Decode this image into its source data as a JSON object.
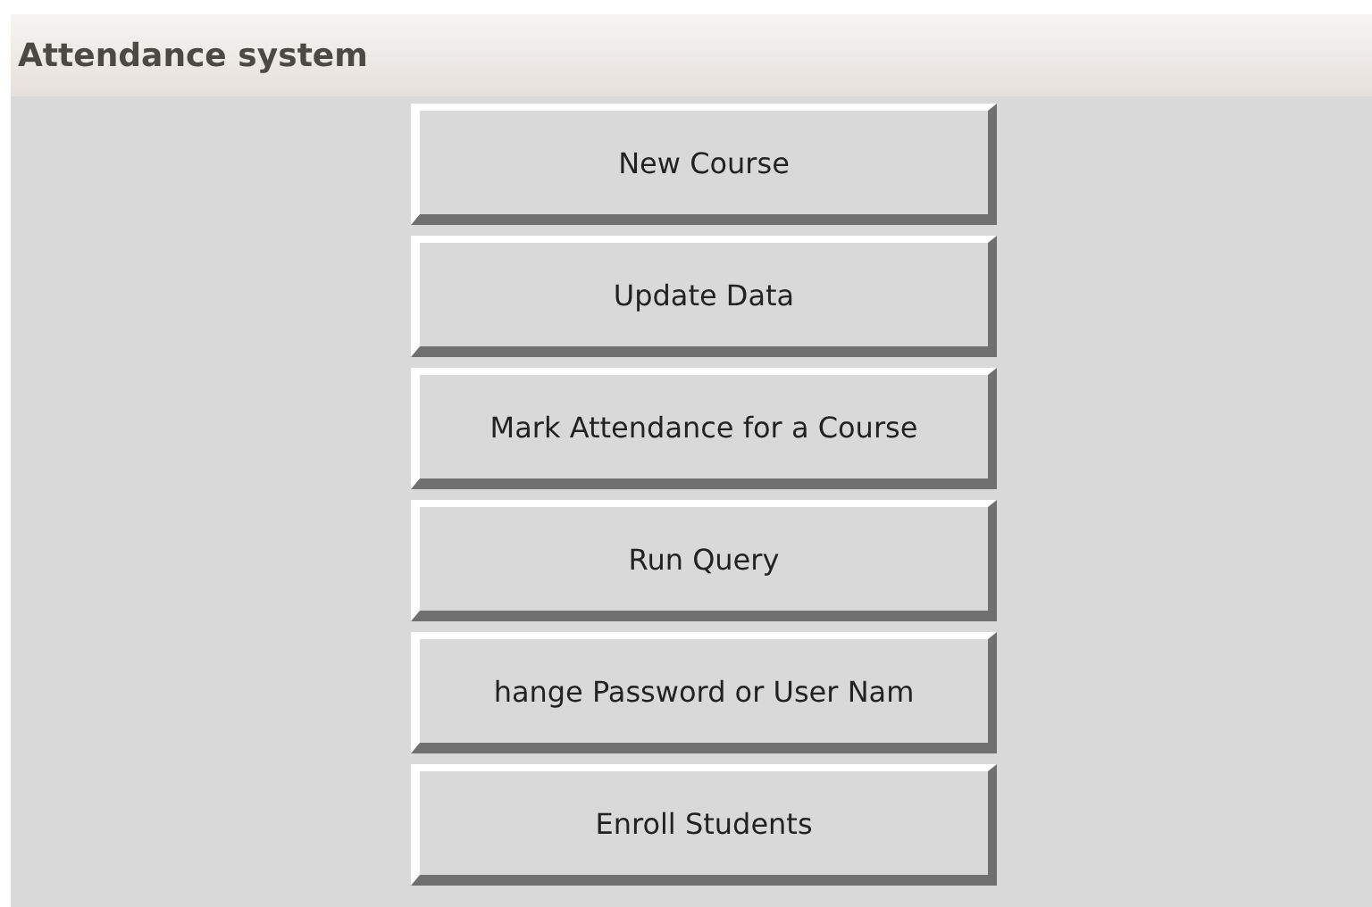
{
  "window": {
    "title": "Attendance system"
  },
  "buttons": [
    {
      "label": "New Course"
    },
    {
      "label": "Update Data"
    },
    {
      "label": "Mark Attendance for a Course"
    },
    {
      "label": "Run Query"
    },
    {
      "label": "hange Password or User Nam"
    },
    {
      "label": "Enroll Students"
    }
  ]
}
